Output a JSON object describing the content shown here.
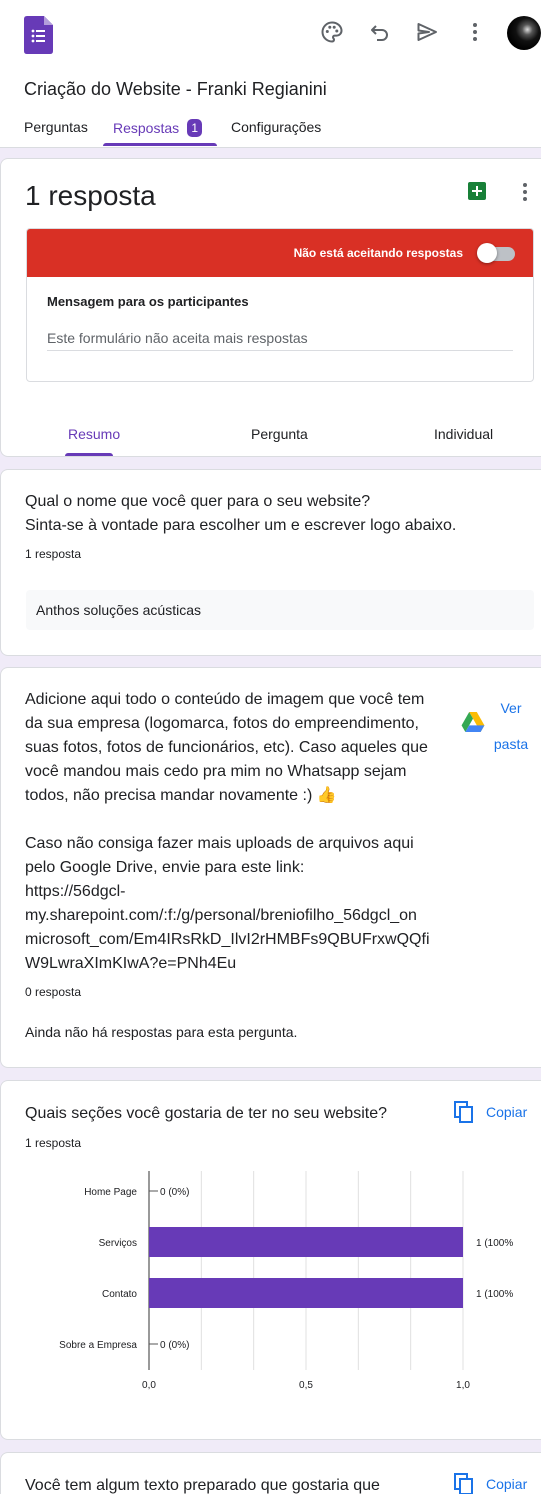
{
  "header": {
    "form_title": "Criação do Website - Franki Regianini",
    "tabs": [
      {
        "label": "Perguntas"
      },
      {
        "label": "Respostas",
        "badge": "1"
      },
      {
        "label": "Configurações"
      }
    ],
    "icons": [
      "forms-icon",
      "palette-icon",
      "undo-icon",
      "send-icon",
      "more-vert-icon",
      "avatar"
    ]
  },
  "summary": {
    "title": "1 resposta",
    "accept_banner": "Não está aceitando respostas",
    "accepting": false,
    "message_label": "Mensagem para os participantes",
    "message_value": "Este formulário não aceita mais respostas",
    "subtabs": [
      {
        "label": "Resumo"
      },
      {
        "label": "Pergunta"
      },
      {
        "label": "Individual"
      }
    ]
  },
  "questions": [
    {
      "lines": [
        "Qual o nome que você quer para o seu website?",
        "Sinta-se à vontade para escolher um e escrever logo abaixo."
      ],
      "count": "1 resposta",
      "answer": "Anthos soluções acústicas"
    },
    {
      "lines": [
        "Adicione aqui todo o conteúdo de imagem que você tem",
        "da sua empresa (logomarca, fotos do empreendimento,",
        "suas fotos, fotos de funcionários, etc). Caso aqueles que",
        "você mandou mais cedo pra mim no Whatsapp sejam",
        "todos, não precisa mandar novamente :) 👍",
        "",
        "Caso não consiga fazer mais uploads de arquivos aqui",
        "pelo Google Drive, envie para este link:",
        "https://56dgcl-",
        "my.sharepoint.com/:f:/g/personal/breniofilho_56dgcl_on",
        "microsoft_com/Em4IRsRkD_IlvI2rHMBFs9QBUFrxwQQfi",
        "W9LwraXImKIwA?e=PNh4Eu"
      ],
      "count": "0 resposta",
      "folder_link": "Ver pasta",
      "empty_text": "Ainda não há respostas para esta pergunta."
    },
    {
      "title": "Quais seções você gostaria de ter no seu website?",
      "count": "1 resposta",
      "copy_label": "Copiar"
    },
    {
      "title": "Você tem algum texto preparado que gostaria que",
      "copy_label": "Copiar"
    }
  ],
  "chart_data": {
    "type": "bar",
    "orientation": "horizontal",
    "categories": [
      "Home Page",
      "Serviços",
      "Contato",
      "Sobre a Empresa"
    ],
    "values": [
      0,
      1,
      1,
      0
    ],
    "data_labels": [
      "0 (0%)",
      "1 (100%",
      "1 (100%",
      "0 (0%)"
    ],
    "xlim": [
      0,
      1
    ],
    "xticks": [
      "0,0",
      "0,5",
      "1,0"
    ],
    "grid": true,
    "color": "#673ab7"
  },
  "colors": {
    "accent": "#673ab7",
    "background": "#f0ebf8",
    "banner": "#d93025",
    "link": "#1a73e8",
    "sheets": "#188038"
  }
}
